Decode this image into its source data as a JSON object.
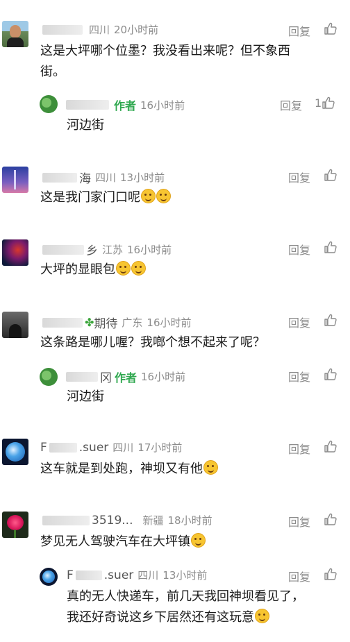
{
  "labels": {
    "reply": "回复",
    "author": "作者"
  },
  "colors": {
    "author": "#2fa84f",
    "meta": "#8c8c8c",
    "text": "#1a1a1a"
  },
  "comments": [
    {
      "name_visible": "",
      "location": "四川",
      "time": "20小时前",
      "text_line1": "这是大坪哪个位墨？我没看出来呢？但不象西",
      "text_line2": "街。",
      "reply": {
        "location": "",
        "time": "16小时前",
        "likes": "1",
        "text": "河边街"
      }
    },
    {
      "name_visible": "海",
      "location": "四川",
      "time": "13小时前",
      "text_line1": "这是我门家门口呢"
    },
    {
      "name_visible": "乡",
      "location": "江苏",
      "time": "16小时前",
      "text_line1": "大坪的显眼包"
    },
    {
      "name_visible": "期待",
      "location": "广东",
      "time": "16小时前",
      "text_line1": "这条路是哪儿喔？我啷个想不起来了呢？",
      "reply": {
        "name_visible": "冈",
        "time": "16小时前",
        "text": "河边街"
      }
    },
    {
      "name_prefix": "F",
      "name_visible": ".suer",
      "location": "四川",
      "time": "17小时前",
      "text_line1": "这车就是到处跑，神坝又有他"
    },
    {
      "name_visible": "3519...",
      "location": "新疆",
      "time": "18小时前",
      "text_line1": "梦见无人驾驶汽车在大坪镇",
      "reply": {
        "name_prefix": "F",
        "name_visible": ".suer",
        "location": "四川",
        "time": "13小时前",
        "text_line1": "真的无人快递车，前几天我回神坝看见了，",
        "text_line2": "我还好奇说这乡下居然还有这玩意"
      }
    }
  ]
}
